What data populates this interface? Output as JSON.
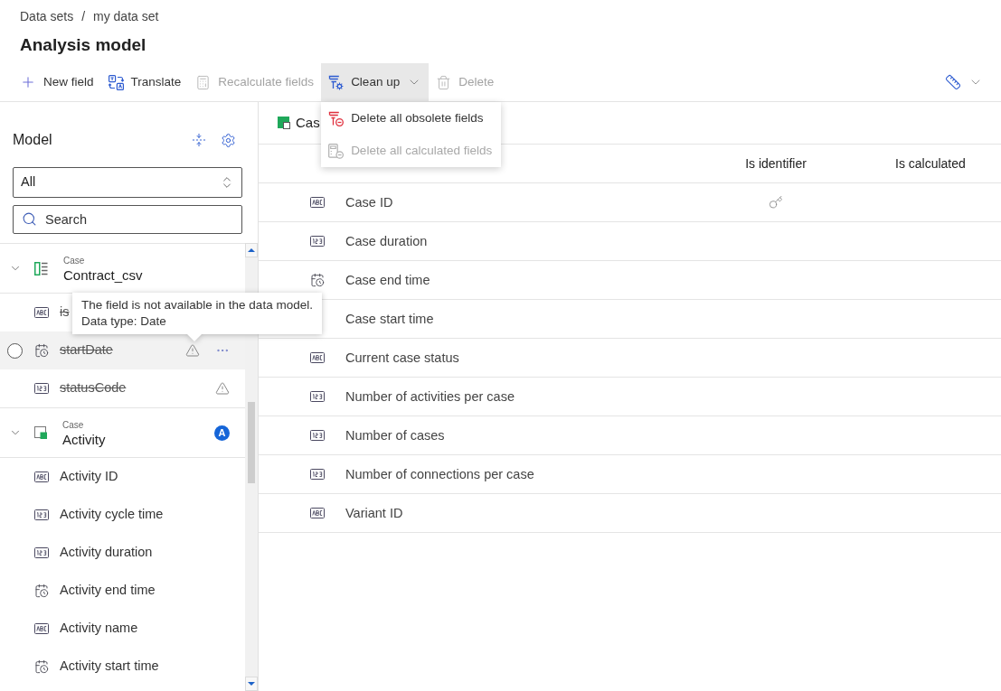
{
  "breadcrumb": {
    "items": [
      "Data sets",
      "my data set"
    ],
    "separator": "/"
  },
  "title": "Analysis model",
  "toolbar": {
    "buttons": [
      {
        "kind": "add",
        "label": "New field",
        "disabled": false
      },
      {
        "kind": "translate",
        "label": "Translate",
        "disabled": false
      },
      {
        "kind": "recalculate",
        "label": "Recalculate fields",
        "disabled": true
      },
      {
        "kind": "cleanup",
        "label": "Clean up",
        "disabled": false,
        "expanded": true,
        "menu": [
          {
            "kind": "obsolete",
            "label": "Delete all obsolete fields",
            "disabled": false
          },
          {
            "kind": "calculated",
            "label": "Delete all calculated fields",
            "disabled": true
          }
        ]
      },
      {
        "kind": "delete",
        "label": "Delete",
        "disabled": true
      }
    ]
  },
  "model": {
    "title": "Model",
    "filter": {
      "value": "All"
    },
    "search": {
      "placeholder": "Search"
    },
    "groups": [
      {
        "kind": "table",
        "label": "Case",
        "name": "Contract_csv",
        "expanded": true,
        "children": [
          {
            "kind": "text",
            "name": "is",
            "obsolete": true,
            "warning": false,
            "hovered": false
          },
          {
            "kind": "date",
            "name": "startDate",
            "obsolete": true,
            "warning": true,
            "hovered": true,
            "tooltip": [
              "The field is not available in the data model.",
              "Data type: Date"
            ]
          },
          {
            "kind": "number",
            "name": "statusCode",
            "obsolete": true,
            "warning": true,
            "hovered": false
          }
        ]
      },
      {
        "kind": "events",
        "label": "Case",
        "name": "Activity",
        "badge": "A",
        "expanded": true,
        "children": [
          {
            "kind": "text",
            "name": "Activity ID",
            "obsolete": false,
            "warning": false,
            "hovered": false
          },
          {
            "kind": "number",
            "name": "Activity cycle time",
            "obsolete": false,
            "warning": false,
            "hovered": false
          },
          {
            "kind": "number",
            "name": "Activity duration",
            "obsolete": false,
            "warning": false,
            "hovered": false
          },
          {
            "kind": "date",
            "name": "Activity end time",
            "obsolete": false,
            "warning": false,
            "hovered": false
          },
          {
            "kind": "text",
            "name": "Activity name",
            "obsolete": false,
            "warning": false,
            "hovered": false
          },
          {
            "kind": "date",
            "name": "Activity start time",
            "obsolete": false,
            "warning": false,
            "hovered": false
          }
        ]
      }
    ]
  },
  "table": {
    "heading": {
      "kind": "case",
      "text": "Cas"
    },
    "columns": [
      "Is identifier",
      "Is calculated"
    ],
    "rows": [
      {
        "kind": "text",
        "name": "Case ID",
        "identifier": true
      },
      {
        "kind": "number",
        "name": "Case duration",
        "identifier": false
      },
      {
        "kind": "date",
        "name": "Case end time",
        "identifier": false
      },
      {
        "name": "Case start time",
        "identifier": false
      },
      {
        "kind": "text",
        "name": "Current case status",
        "identifier": false
      },
      {
        "kind": "number",
        "name": "Number of activities per case",
        "identifier": false
      },
      {
        "kind": "number",
        "name": "Number of cases",
        "identifier": false
      },
      {
        "kind": "number",
        "name": "Number of connections per case",
        "identifier": false
      },
      {
        "kind": "text",
        "name": "Variant ID",
        "identifier": false
      }
    ]
  }
}
